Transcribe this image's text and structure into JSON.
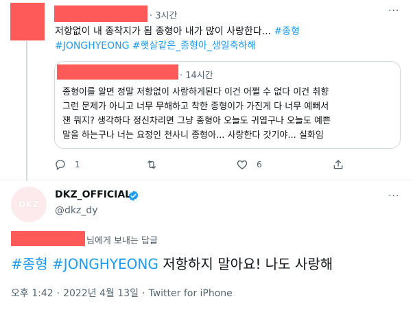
{
  "reply_tweet": {
    "time": "3시간",
    "more": "···",
    "text": "저항없이 내 종착지가 됨 종형아 내가 많이 사랑한다... ",
    "tags_line1": "#종형",
    "tags_line2": "#JONGHYEONG #햇살같은_종형아_생일축하해"
  },
  "quoted_tweet": {
    "time": "14시간",
    "line1": "종형이를 알면 정말 저항없이 사랑하게된다 이건 어쩔 수 없다 이건 취향",
    "line2": "그런 문제가 아니고 너무 무해하고 착한 종형이가 가진게 다 너무 예뻐서",
    "line3": "쟨 뭐지? 생각하다 정신차리면 그냥 종형아 오늘도 귀엽구나 오늘도 예쁜",
    "line4": "말을 하는구나 너는 요정인 천사니 종형아... 사랑한다 갓기야... 실화임"
  },
  "actions": {
    "reply_count": "1",
    "retweet_count": "",
    "like_count": "6"
  },
  "main_tweet": {
    "avatar_text": "DKZ",
    "display_name": "DKZ_OFFICIAL",
    "handle": "@dkz_dy",
    "more": "···",
    "reply_to_suffix": "님에게 보내는 답글",
    "tag1": "#종형",
    "tag2": "#JONGHYEONG",
    "text": " 저항하지 말아요! 나도 사랑해",
    "time": "오후 1:42",
    "date": "2022년 4월 13일",
    "source": "Twitter for iPhone",
    "separator": "·"
  },
  "colors": {
    "accent": "#1d9bf0",
    "redaction": "#ff5a5a",
    "secondary_text": "#536471"
  },
  "icons": [
    "reply-icon",
    "retweet-icon",
    "like-icon",
    "share-icon",
    "verified-badge-icon",
    "more-icon"
  ]
}
